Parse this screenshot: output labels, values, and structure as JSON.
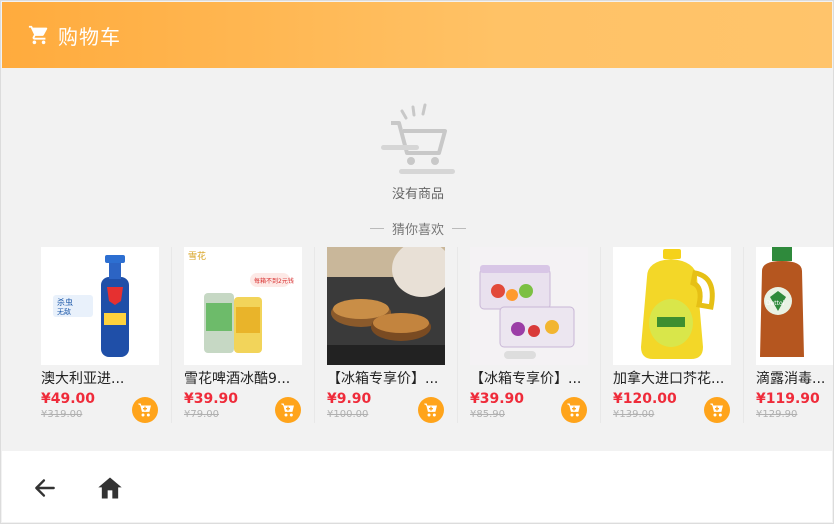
{
  "header": {
    "title": "购物车",
    "icon": "cart-icon"
  },
  "empty": {
    "text": "没有商品",
    "icon": "empty-cart-icon"
  },
  "recommend": {
    "title": "猜你喜欢"
  },
  "products": [
    {
      "name": "澳大利亚进...",
      "price": "¥49.00",
      "old_price": "¥319.00"
    },
    {
      "name": "雪花啤酒冰酷9...",
      "price": "¥39.90",
      "old_price": "¥79.00"
    },
    {
      "name": "【冰箱专享价】...",
      "price": "¥9.90",
      "old_price": "¥100.00"
    },
    {
      "name": "【冰箱专享价】...",
      "price": "¥39.90",
      "old_price": "¥85.90"
    },
    {
      "name": "加拿大进口芥花...",
      "price": "¥120.00",
      "old_price": "¥139.00"
    },
    {
      "name": "滴露消毒...",
      "price": "¥119.90",
      "old_price": "¥129.90"
    }
  ],
  "colors": {
    "accent": "#ffa41b",
    "price": "#ef2b3a",
    "header_start": "#ffab3d",
    "header_end": "#ffc46b"
  },
  "nav": {
    "back_icon": "back-arrow-icon",
    "home_icon": "home-icon"
  }
}
